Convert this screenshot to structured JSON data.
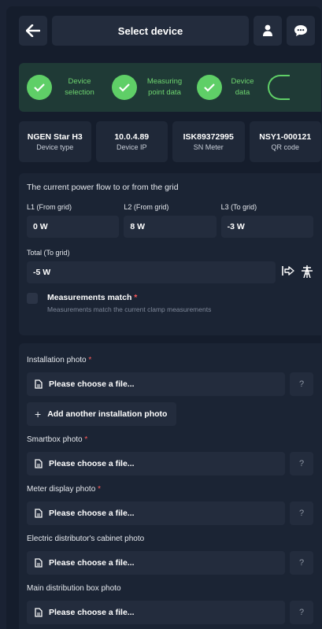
{
  "header": {
    "title": "Select device"
  },
  "steps": [
    {
      "label": "Device selection"
    },
    {
      "label": "Measuring point data"
    },
    {
      "label": "Device data"
    }
  ],
  "device_info": [
    {
      "value": "NGEN Star H3",
      "label": "Device type"
    },
    {
      "value": "10.0.4.89",
      "label": "Device IP"
    },
    {
      "value": "ISK89372995",
      "label": "SN Meter"
    },
    {
      "value": "NSY1-000121",
      "label": "QR code"
    }
  ],
  "power_flow": {
    "title": "The current power flow to or from the grid",
    "l1": {
      "label": "L1 (From grid)",
      "value": "0 W"
    },
    "l2": {
      "label": "L2 (From grid)",
      "value": "8 W"
    },
    "l3": {
      "label": "L3 (To grid)",
      "value": "-3 W"
    },
    "total": {
      "label": "Total (To grid)",
      "value": "-5 W"
    },
    "match": {
      "label": "Measurements match",
      "required_mark": "*",
      "hint": "Measurements match the current clamp measurements"
    }
  },
  "photos": {
    "placeholder": "Please choose a file...",
    "help": "?",
    "add_another": "Add another installation photo",
    "fields": [
      {
        "label": "Installation photo",
        "required": "*"
      },
      {
        "label": "Smartbox photo",
        "required": "*"
      },
      {
        "label": "Meter display photo",
        "required": "*"
      },
      {
        "label": "Electric distributor's cabinet photo",
        "required": ""
      },
      {
        "label": "Main distribution box photo",
        "required": ""
      }
    ]
  },
  "colors": {
    "accent_green": "#5fcf67",
    "required_red": "#ff5a5a",
    "panel": "#1b2434"
  }
}
